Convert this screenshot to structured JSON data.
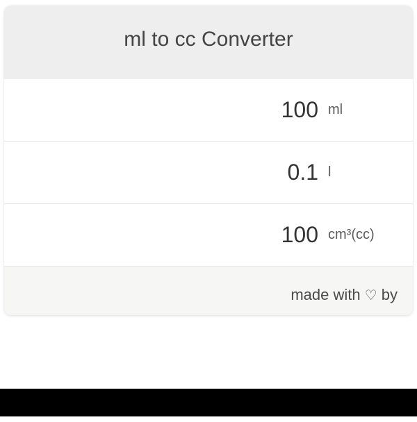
{
  "header": {
    "title": "ml to cc Converter"
  },
  "rows": [
    {
      "value": "100",
      "unit": "ml"
    },
    {
      "value": "0.1",
      "unit": "l"
    },
    {
      "value": "100",
      "unit": "cm³(cc)"
    }
  ],
  "footer": {
    "prefix": "made with ",
    "heart": "♡",
    "suffix": " by"
  }
}
